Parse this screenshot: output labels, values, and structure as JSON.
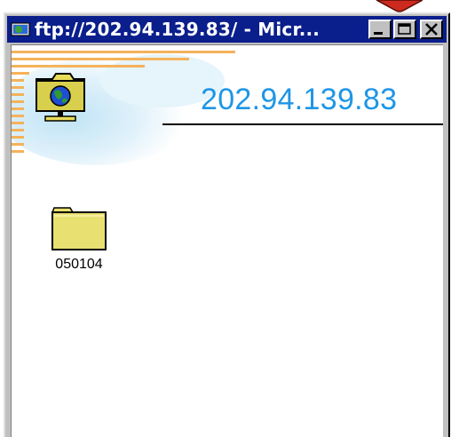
{
  "window": {
    "title": "ftp://202.94.139.83/ - Micr...",
    "title_icon": "ie-page-icon",
    "controls": [
      "minimize",
      "maximize",
      "close"
    ]
  },
  "header": {
    "title": "202.94.139.83",
    "icon": "network-globe-folder-icon"
  },
  "items": [
    {
      "label": "050104",
      "icon": "folder-icon"
    }
  ],
  "colors": {
    "titlebar": "#0a1e8c",
    "header_text": "#1e96e6",
    "stripes": "#f5b25a",
    "folder": "#e8e070"
  }
}
